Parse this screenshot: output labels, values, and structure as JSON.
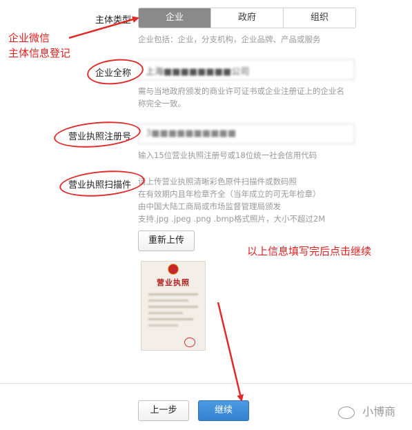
{
  "form": {
    "subject_type_label": "主体类型",
    "subject_tabs": [
      "企业",
      "政府",
      "组织"
    ],
    "subject_hint": "企业包括：企业，分支机构，企业品牌、产品或服务",
    "full_name_label": "企业全称",
    "full_name_value": "上海■■■■■■■■公司",
    "full_name_hint_line1": "需与当地政府颁发的商业许可证书或企业注册证上的企业名",
    "full_name_hint_line2": "称完全一致。",
    "license_no_label": "营业执照注册号",
    "license_no_value": "3■■■■■■■■■■",
    "license_no_hint": "输入15位营业执照注册号或18位统一社会信用代码",
    "scan_label": "营业执照扫描件",
    "scan_hint_line1": "请上传营业执照清晰彩色原件扫描件或数码照",
    "scan_hint_line2": "在有效期内且年检章齐全（当年成立的可无年检章）",
    "scan_hint_line3": "由中国大陆工商局或市场监督管理局颁发",
    "scan_hint_line4": "支持.jpg .jpeg .png .bmp格式照片，大小不超过2M",
    "reupload_button": "重新上传",
    "license_image_title": "营业执照"
  },
  "footer": {
    "prev_button": "上一步",
    "next_button": "继续"
  },
  "annotations": {
    "note_top_line1": "企业微信",
    "note_top_line2": "主体信息登记",
    "note_continue": "以上信息填写完后点击继续",
    "accent_color": "#e02020"
  },
  "watermark": {
    "text": "小博商",
    "icon": "wechat-icon"
  }
}
